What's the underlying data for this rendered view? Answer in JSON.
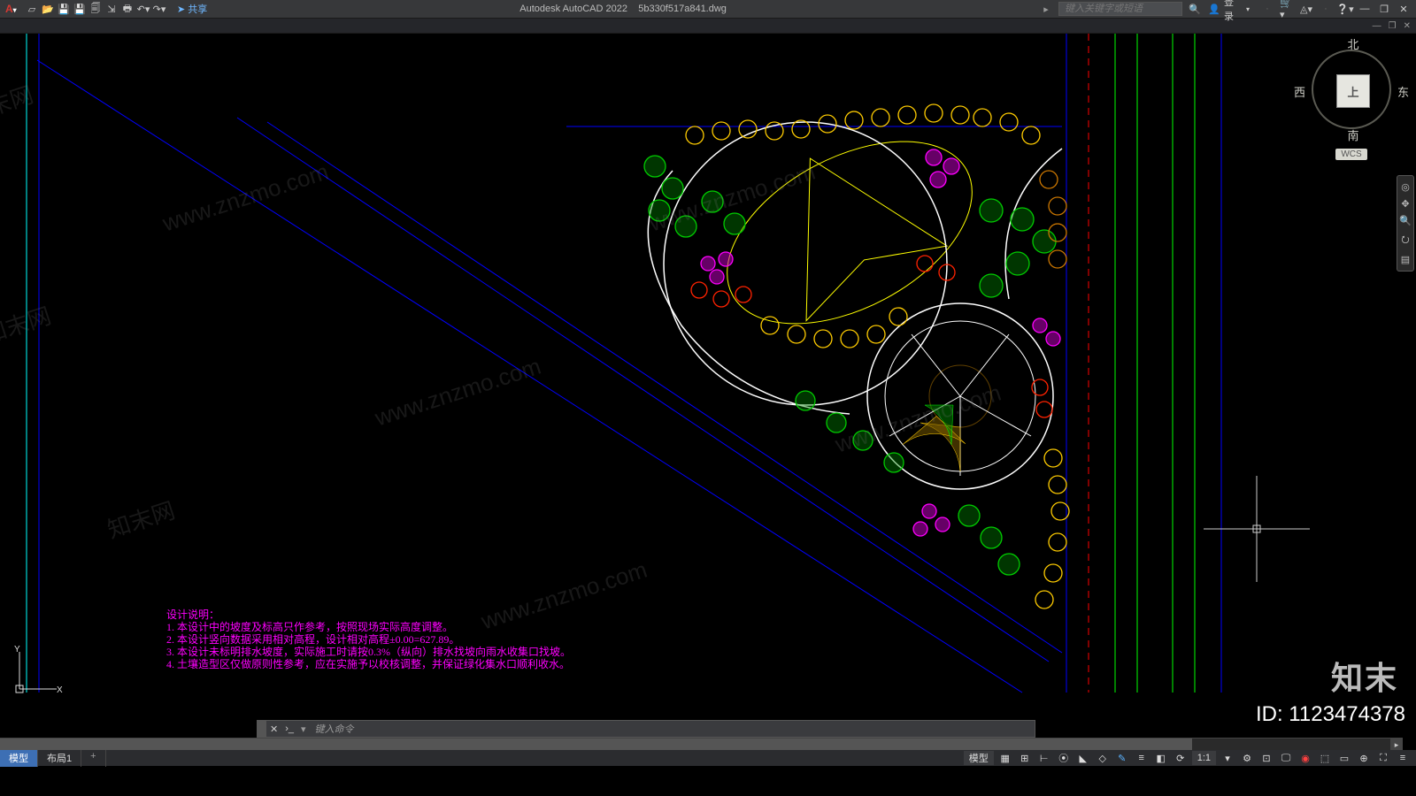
{
  "app": {
    "title": "Autodesk AutoCAD 2022",
    "filename": "5b330f517a841.dwg"
  },
  "qat": {
    "share": "共享"
  },
  "search": {
    "placeholder": "键入关键字或短语",
    "login": "登录"
  },
  "ribbon_right": [
    "▫",
    "□",
    "✕"
  ],
  "viewcube": {
    "n": "北",
    "s": "南",
    "e": "东",
    "w": "西",
    "top": "上",
    "wcs": "WCS"
  },
  "cmd": {
    "placeholder": "键入命令"
  },
  "tabs": {
    "model": "模型",
    "layout1": "布局1",
    "plus": "+"
  },
  "status_right": {
    "label": "模型",
    "ratio": "1:1",
    "gear": "⚙"
  },
  "notes": {
    "title": "设计说明：",
    "l1": "1. 本设计中的坡度及标高只作参考，按照现场实际高度调整。",
    "l2": "2. 本设计竖向数据采用相对高程，设计相对高程±0.00=627.89。",
    "l3": "3. 本设计未标明排水坡度，实际施工时请按0.3%（纵向）排水找坡向雨水收集口找坡。",
    "l4": "4. 土壤造型区仅做原则性参考，应在实施予以校核调整，并保证绿化集水口顺利收水。"
  },
  "brand": "知末",
  "id_label": "ID: 1123474378",
  "watermark_a": "知末网",
  "watermark_b": "www.znzmo.com"
}
